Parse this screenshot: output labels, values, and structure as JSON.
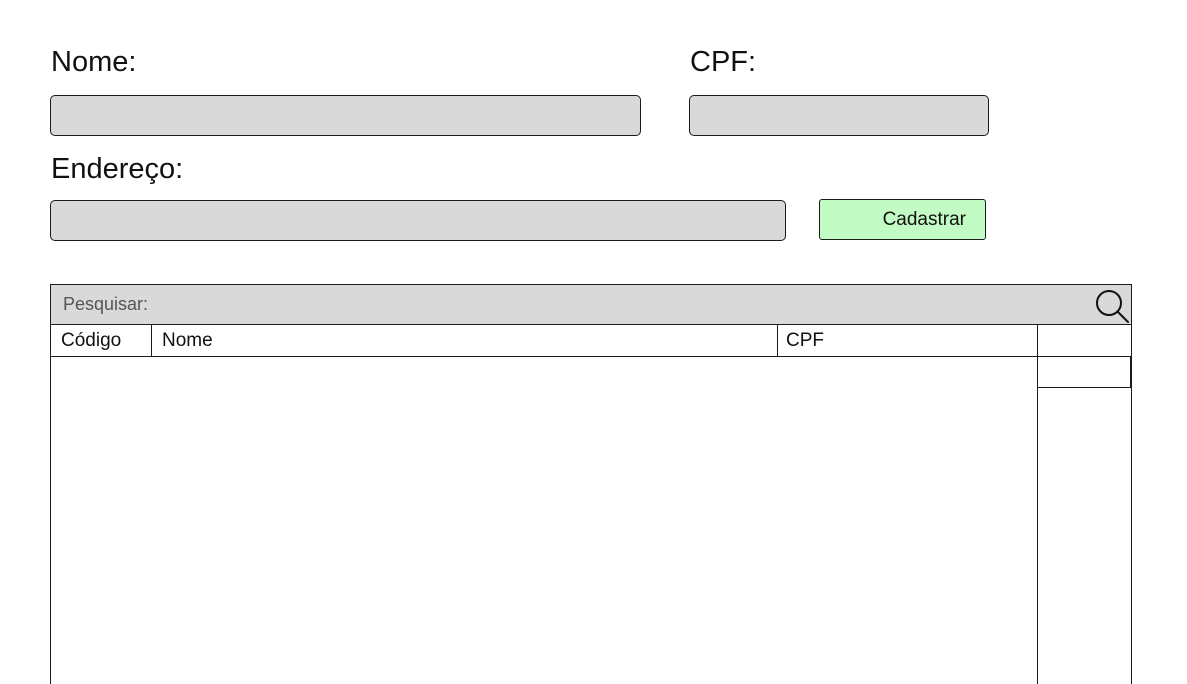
{
  "form": {
    "nome_label": "Nome:",
    "nome_value": "",
    "cpf_label": "CPF:",
    "cpf_value": "",
    "endereco_label": "Endereço:",
    "endereco_value": "",
    "submit_label": "Cadastrar"
  },
  "search": {
    "placeholder": "Pesquisar:",
    "icon": "search-icon"
  },
  "table": {
    "columns": [
      "Código",
      "Nome",
      "CPF"
    ],
    "rows": []
  },
  "colors": {
    "field_bg": "#d9d9d9",
    "button_bg": "#c2fbc3",
    "border": "#1a1a1a"
  }
}
